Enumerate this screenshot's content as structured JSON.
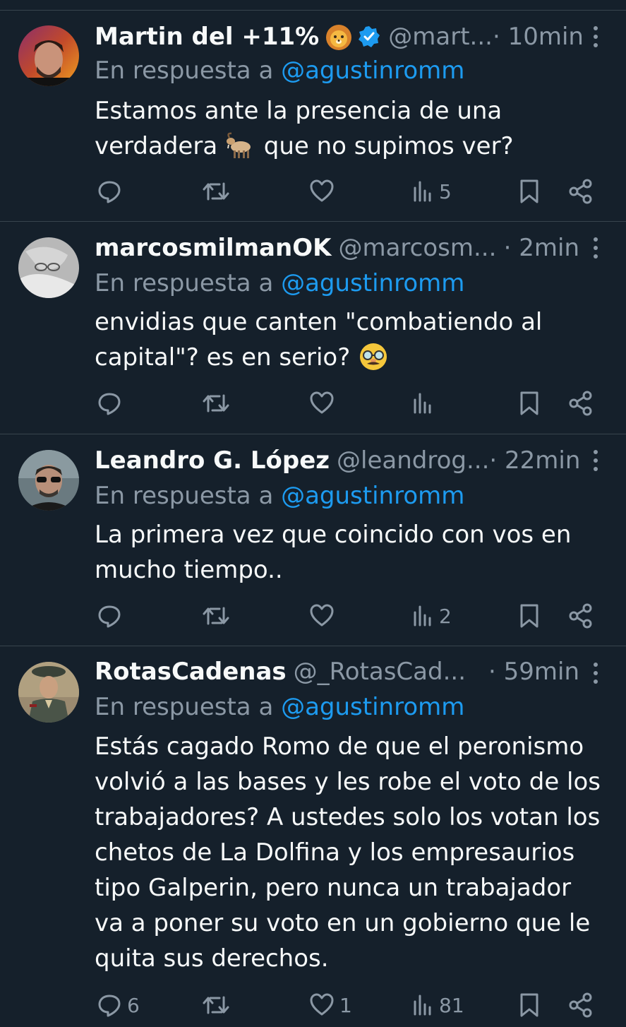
{
  "tweets": [
    {
      "name": "Martin del +11%",
      "name_emoji": "lion-face",
      "verified": true,
      "handle": "@mart...",
      "time": "· 10min",
      "reply_prefix": "En respuesta a ",
      "reply_to": "@agustinromm",
      "text_parts": [
        "Estamos ante la presencia de una verdadera ",
        " que no supimos ver?"
      ],
      "inline_emoji": "goat",
      "counts": {
        "reply": "",
        "retweet": "",
        "like": "",
        "views": "5"
      }
    },
    {
      "name": "marcosmilmanOK",
      "verified": false,
      "handle": "@marcosm...",
      "time": "· 2min",
      "reply_prefix": "En respuesta a ",
      "reply_to": "@agustinromm",
      "text_parts": [
        "envidias que canten \"combatiendo al capital\"? es en serio? ",
        ""
      ],
      "inline_emoji": "disguised-face",
      "counts": {
        "reply": "",
        "retweet": "",
        "like": "",
        "views": ""
      }
    },
    {
      "name": "Leandro G. López",
      "verified": false,
      "handle": "@leandrog...",
      "time": "· 22min",
      "reply_prefix": "En respuesta a ",
      "reply_to": "@agustinromm",
      "text_parts": [
        "La primera vez que coincido con vos en mucho tiempo..",
        ""
      ],
      "counts": {
        "reply": "",
        "retweet": "",
        "like": "",
        "views": "2"
      }
    },
    {
      "name": "RotasCadenas",
      "verified": false,
      "handle": "@_RotasCad...",
      "time": "· 59min",
      "reply_prefix": "En respuesta a ",
      "reply_to": "@agustinromm",
      "text_parts": [
        "Estás cagado Romo de que el peronismo volvió a las bases y les robe el voto de los trabajadores? A ustedes solo los votan los chetos de La Dolfina y los empresaurios tipo Galperin, pero nunca un trabajador va a poner su voto en un gobierno que le quita sus derechos.",
        ""
      ],
      "counts": {
        "reply": "6",
        "retweet": "",
        "like": "1",
        "views": "81"
      }
    }
  ],
  "colors": {
    "background": "#15202b",
    "text": "#f7f9f9",
    "muted": "#8b98a5",
    "accent": "#1d9bf0",
    "divider": "#38444d"
  },
  "icons": [
    "reply-icon",
    "retweet-icon",
    "like-icon",
    "views-icon",
    "bookmark-icon",
    "share-icon",
    "more-icon",
    "verified-badge-icon"
  ]
}
